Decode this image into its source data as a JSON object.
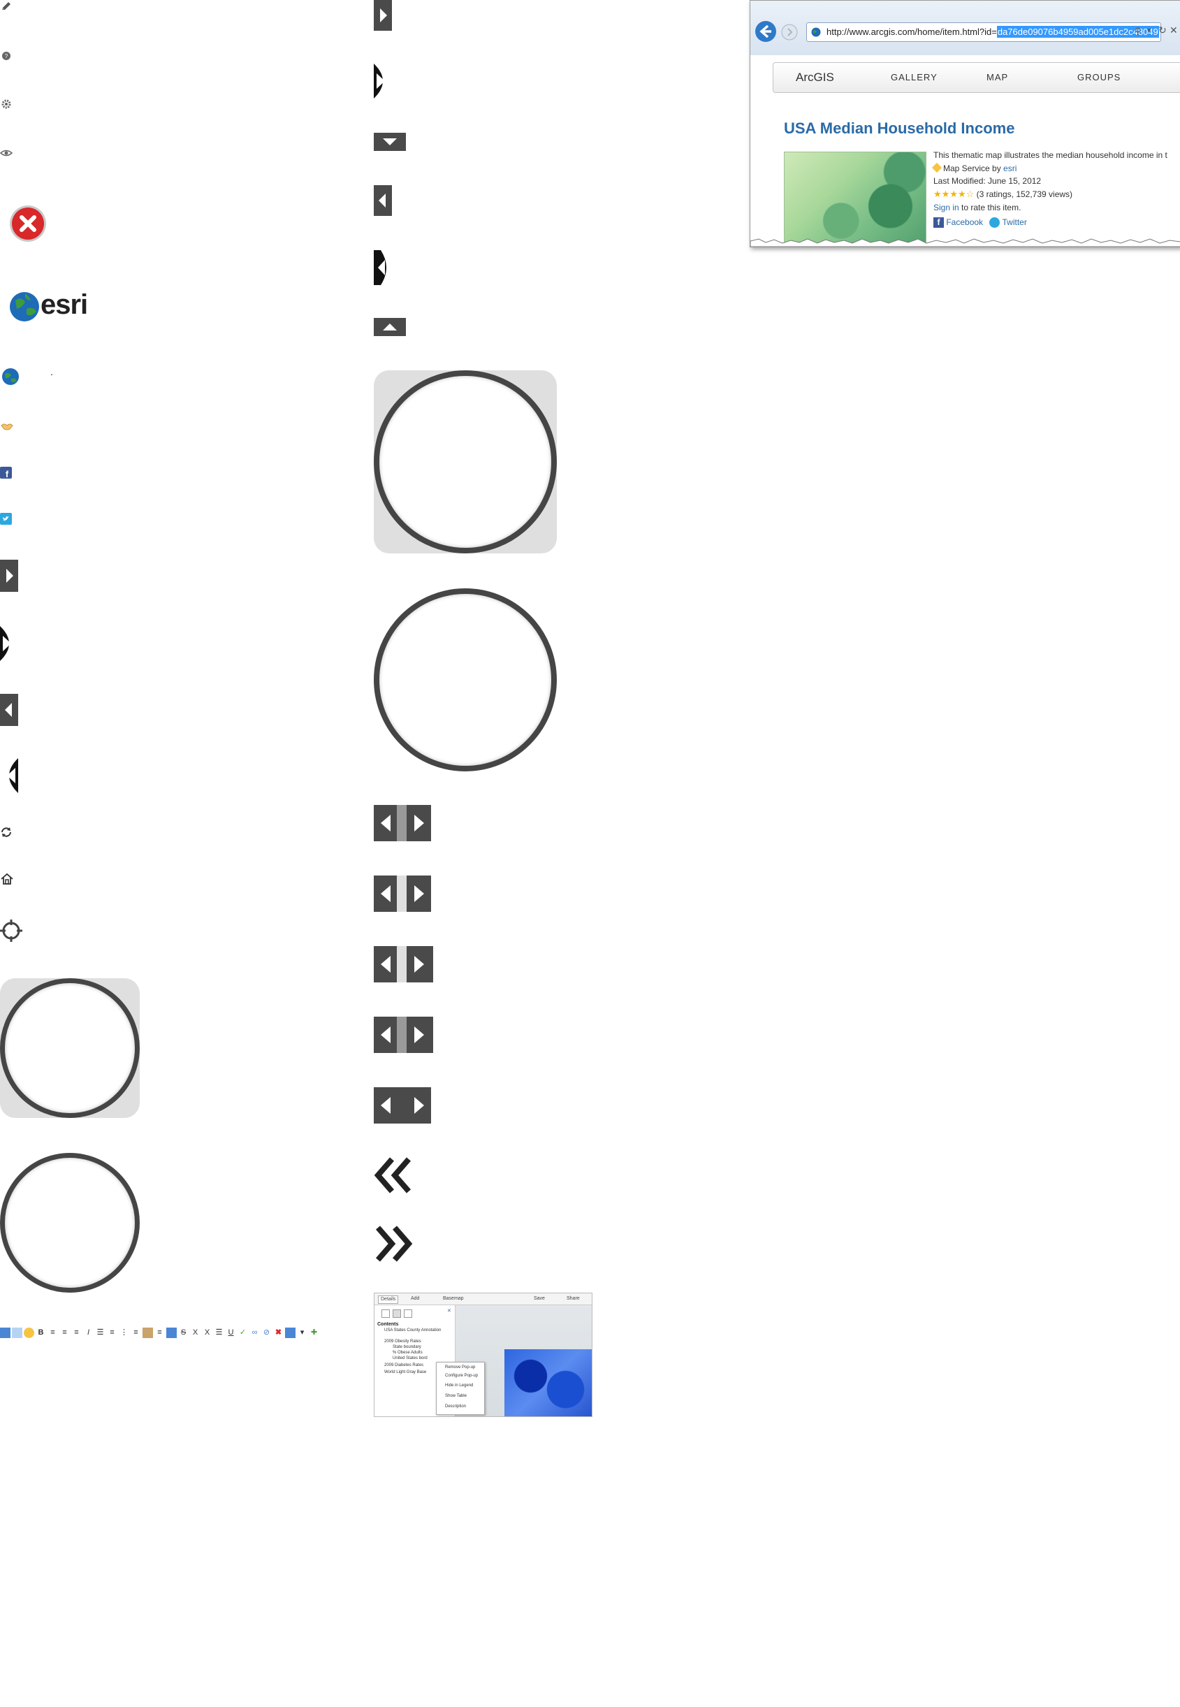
{
  "icons_column1": {
    "edit": "pencil-icon",
    "help": "help-icon",
    "settings": "gear-icon",
    "view": "eye-icon",
    "close": "close-icon",
    "logo_text": "esri",
    "dot": "."
  },
  "browser": {
    "url_base": "http://www.arcgis.com/home/item.html?id=",
    "url_selected": "da76de09076b4959ad005e1dc2c48049",
    "nav": [
      "ArcGIS",
      "GALLERY",
      "MAP",
      "GROUPS"
    ],
    "item_title": "USA Median Household Income",
    "description": "This thematic map illustrates the median household income in t",
    "service_prefix": "Map Service by ",
    "service_owner": "esri",
    "last_modified": "Last Modified: June 15, 2012",
    "ratings": "(3 ratings, 152,739 views)",
    "rating_stars": 3.5,
    "sign_in": "Sign in",
    "rate_text": " to rate this item.",
    "facebook": "Facebook",
    "twitter": "Twitter"
  },
  "map_viewer": {
    "toolbar": [
      "Details",
      "Add",
      "Basemap",
      "Save",
      "Share"
    ],
    "contents_label": "Contents",
    "layers": [
      "USA States County Annotation",
      "2009 Obesity Rates",
      "State boundary",
      "% Obese Adults",
      "United States bord",
      "2009 Diabetes Rates",
      "World Light Gray Base"
    ],
    "context_menu": [
      "Remove Pop-up",
      "Configure Pop-up",
      "Hide in Legend",
      "Show Table",
      "Description"
    ]
  },
  "colors": {
    "dark_gray": "#4a4a4a",
    "ring": "#454545",
    "tile": "#dfdfdf",
    "link": "#2b6aa6",
    "close_red": "#d8282a"
  }
}
